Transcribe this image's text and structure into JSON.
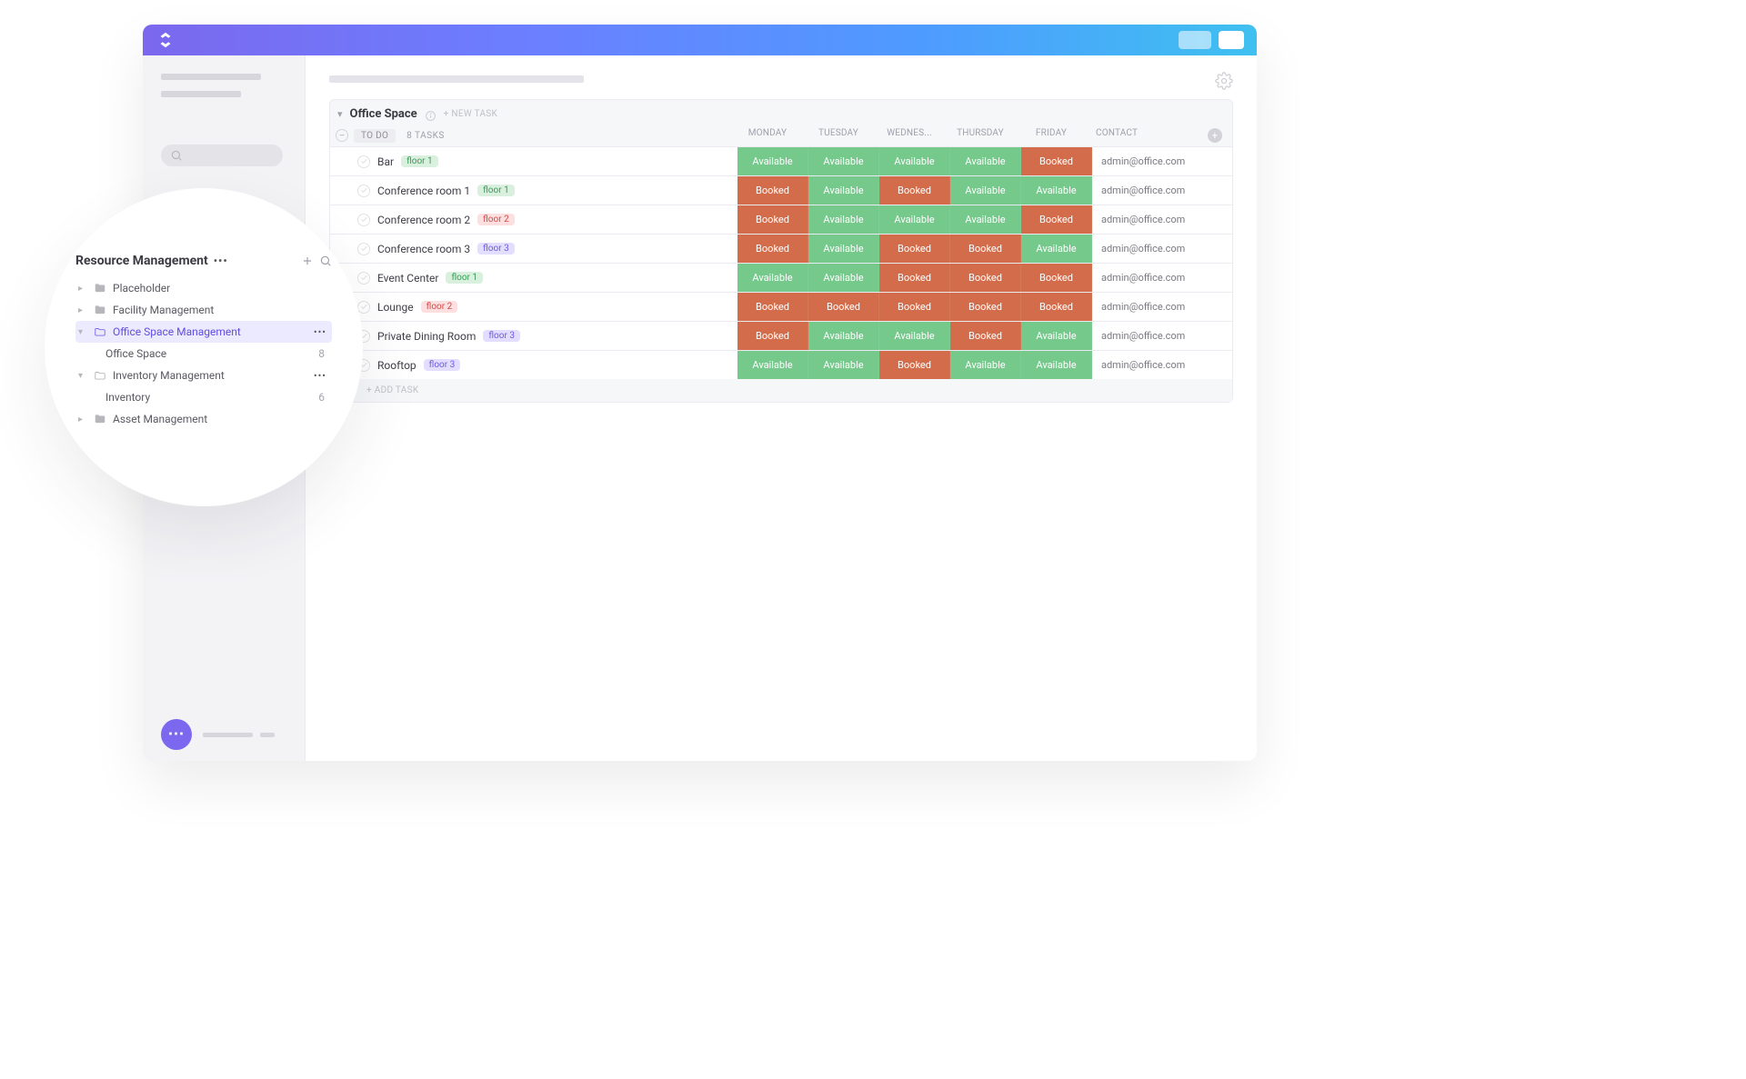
{
  "status_labels": {
    "avail": "Available",
    "booked": "Booked"
  },
  "toolbar": {
    "list_title": "Office Space",
    "new_task_btn": "+ NEW TASK",
    "status_chip": "TO DO",
    "task_count_label": "8 TASKS",
    "add_task_btn": "+ ADD TASK"
  },
  "columns": {
    "mon": "MONDAY",
    "tue": "TUESDAY",
    "wed": "WEDNES...",
    "thu": "THURSDAY",
    "fri": "FRIDAY",
    "contact": "CONTACT"
  },
  "tags": {
    "floor1": "floor 1",
    "floor2": "floor 2",
    "floor3": "floor 3"
  },
  "contact_email": "admin@office.com",
  "tasks": [
    {
      "id": "bar",
      "name": "Bar",
      "tag": "floor1",
      "tag_kind": "green",
      "mon": "avail",
      "tue": "avail",
      "wed": "avail",
      "thu": "avail",
      "fri": "booked"
    },
    {
      "id": "conf1",
      "name": "Conference room 1",
      "tag": "floor1",
      "tag_kind": "green",
      "mon": "booked",
      "tue": "avail",
      "wed": "booked",
      "thu": "avail",
      "fri": "avail"
    },
    {
      "id": "conf2",
      "name": "Conference room 2",
      "tag": "floor2",
      "tag_kind": "red",
      "mon": "booked",
      "tue": "avail",
      "wed": "avail",
      "thu": "avail",
      "fri": "booked"
    },
    {
      "id": "conf3",
      "name": "Conference room 3",
      "tag": "floor3",
      "tag_kind": "purple",
      "mon": "booked",
      "tue": "avail",
      "wed": "booked",
      "thu": "booked",
      "fri": "avail"
    },
    {
      "id": "eventc",
      "name": "Event Center",
      "tag": "floor1",
      "tag_kind": "green",
      "mon": "avail",
      "tue": "avail",
      "wed": "booked",
      "thu": "booked",
      "fri": "booked"
    },
    {
      "id": "lounge",
      "name": "Lounge",
      "tag": "floor2",
      "tag_kind": "red",
      "mon": "booked",
      "tue": "booked",
      "wed": "booked",
      "thu": "booked",
      "fri": "booked"
    },
    {
      "id": "pdining",
      "name": "Private Dining Room",
      "tag": "floor3",
      "tag_kind": "purple",
      "mon": "booked",
      "tue": "avail",
      "wed": "avail",
      "thu": "booked",
      "fri": "avail"
    },
    {
      "id": "rooftop",
      "name": "Rooftop",
      "tag": "floor3",
      "tag_kind": "purple",
      "mon": "avail",
      "tue": "avail",
      "wed": "booked",
      "thu": "avail",
      "fri": "avail"
    }
  ],
  "sidebar": {
    "workspace_title": "Resource Management",
    "items": [
      {
        "label": "Placeholder",
        "kind": "closed-folder",
        "caret": "right",
        "dots": false
      },
      {
        "label": "Facility Management",
        "kind": "closed-folder",
        "caret": "right",
        "dots": false
      },
      {
        "label": "Office Space Management",
        "kind": "open-folder",
        "caret": "down",
        "dots": true,
        "active": true
      },
      {
        "label": "Office Space",
        "kind": "list",
        "caret": "",
        "count": "8",
        "indent": true
      },
      {
        "label": "Inventory Management",
        "kind": "open-folder",
        "caret": "down",
        "dots": true
      },
      {
        "label": "Inventory",
        "kind": "list",
        "caret": "",
        "count": "6",
        "indent": true
      },
      {
        "label": "Asset Management",
        "kind": "closed-folder",
        "caret": "right",
        "dots": false
      }
    ]
  }
}
